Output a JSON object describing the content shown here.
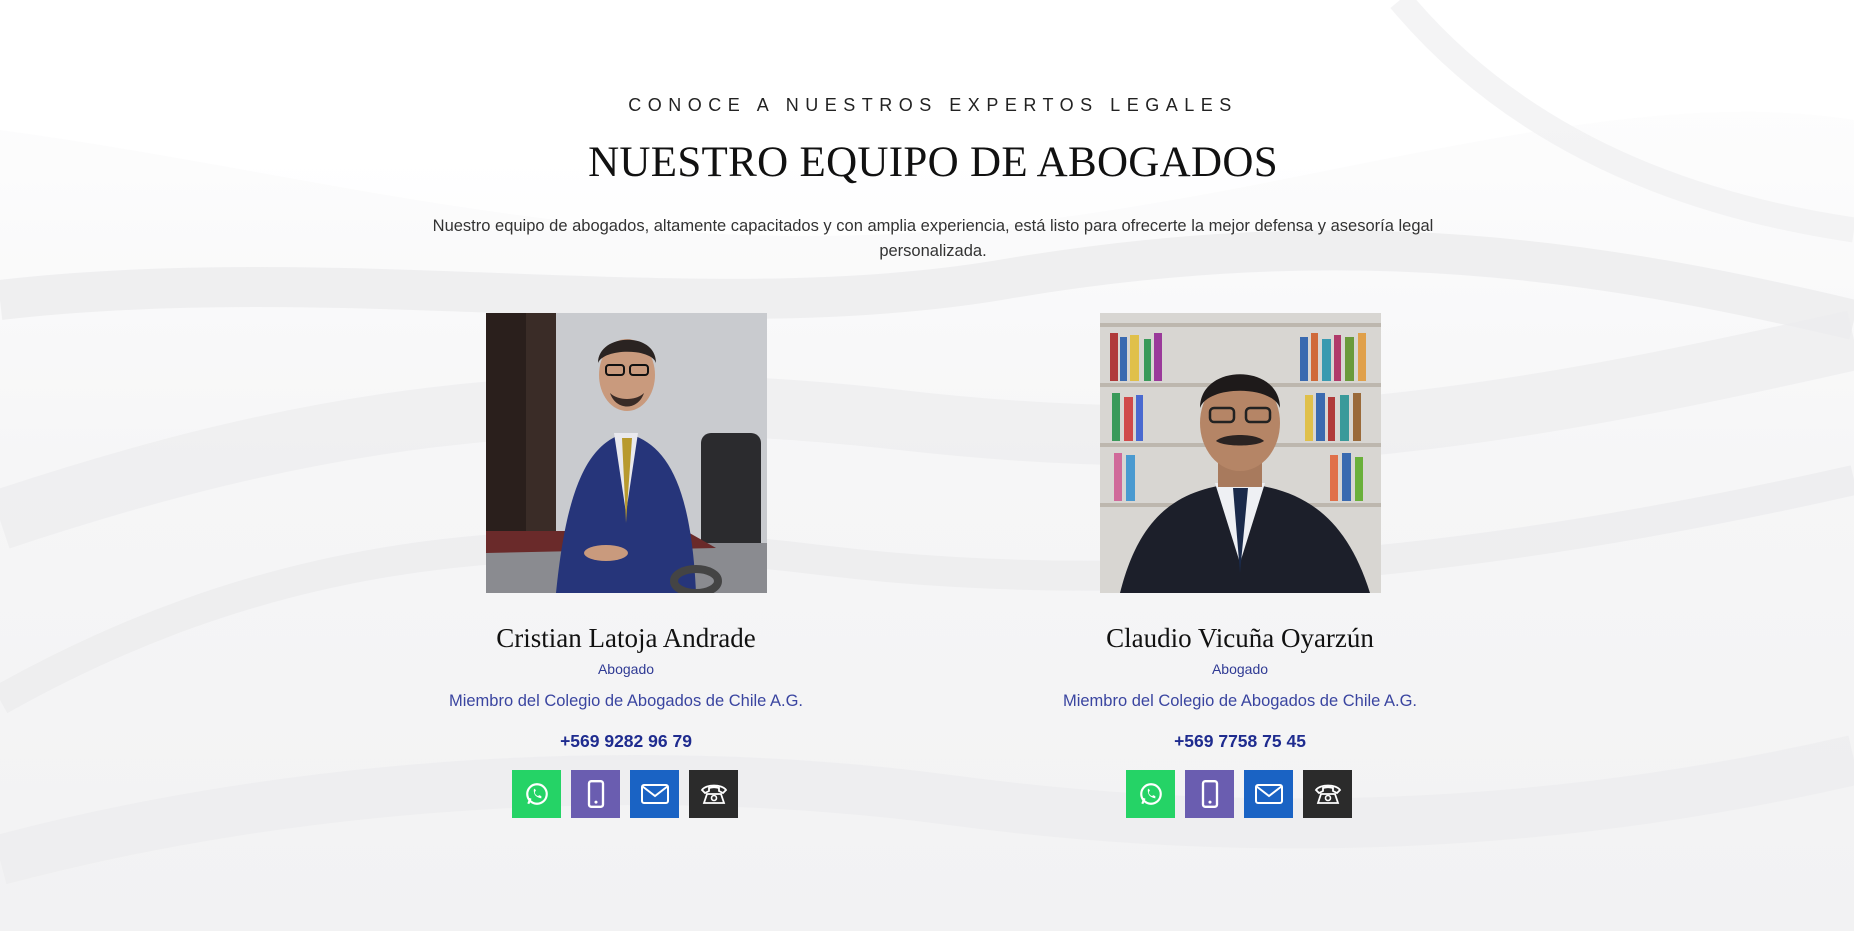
{
  "section": {
    "eyebrow": "CONOCE A NUESTROS EXPERTOS LEGALES",
    "title": "NUESTRO EQUIPO DE ABOGADOS",
    "subtitle": "Nuestro equipo de abogados, altamente capacitados y con amplia experiencia, está listo para ofrecerte la mejor defensa y asesoría legal personalizada."
  },
  "team": [
    {
      "name": "Cristian Latoja Andrade",
      "role": "Abogado",
      "membership": "Miembro del Colegio de Abogados de Chile A.G.",
      "phone": "+569 9282 96 79"
    },
    {
      "name": "Claudio Vicuña Oyarzún",
      "role": "Abogado",
      "membership": "Miembro del Colegio de Abogados de Chile A.G.",
      "phone": "+569 7758 75 45"
    }
  ],
  "contact_icons": [
    {
      "name": "whatsapp-icon",
      "color": "#25d366"
    },
    {
      "name": "mobile-phone-icon",
      "color": "#6a5db0"
    },
    {
      "name": "email-icon",
      "color": "#1a63c4"
    },
    {
      "name": "landline-phone-icon",
      "color": "#2b2b2b"
    }
  ],
  "colors": {
    "accent_text": "#3a45a0",
    "phone_text": "#1f2c8f",
    "background": "#f7f7f8"
  }
}
